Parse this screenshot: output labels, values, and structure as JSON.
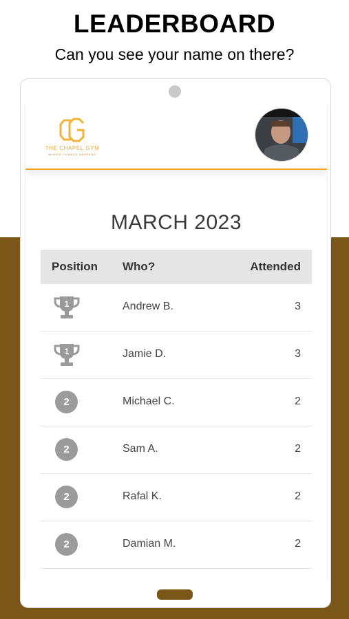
{
  "headline": "LEADERBOARD",
  "subline": "Can you see your name on there?",
  "colors": {
    "brand_brown": "#7b5619",
    "accent_orange": "#f3a523",
    "badge_grey": "#9b9b9b"
  },
  "site_header": {
    "logo": {
      "mark": "CG",
      "name": "THE CHAPEL GYM",
      "tagline": "WHERE CHANGE HAPPENS"
    },
    "avatar": "profile-photo"
  },
  "month_title": "MARCH 2023",
  "table": {
    "headers": {
      "position": "Position",
      "who": "Who?",
      "attended": "Attended"
    },
    "rows": [
      {
        "position": "1",
        "icon": "trophy-icon",
        "who": "Andrew B.",
        "attended": "3"
      },
      {
        "position": "1",
        "icon": "trophy-icon",
        "who": "Jamie D.",
        "attended": "3"
      },
      {
        "position": "2",
        "icon": "badge",
        "who": "Michael C.",
        "attended": "2"
      },
      {
        "position": "2",
        "icon": "badge",
        "who": "Sam A.",
        "attended": "2"
      },
      {
        "position": "2",
        "icon": "badge",
        "who": "Rafal K.",
        "attended": "2"
      },
      {
        "position": "2",
        "icon": "badge",
        "who": "Damian M.",
        "attended": "2"
      }
    ]
  }
}
